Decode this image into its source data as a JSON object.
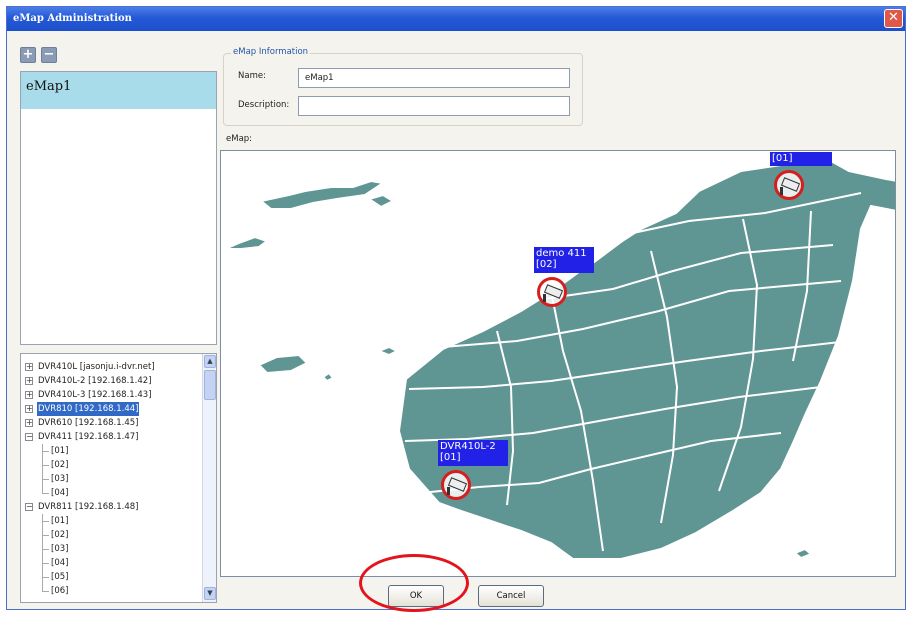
{
  "window": {
    "title": "eMap Administration",
    "close_glyph": "✕"
  },
  "toolbar": {
    "add_glyph": "+",
    "remove_glyph": "−"
  },
  "map_list": [
    "eMap1"
  ],
  "device_tree": [
    {
      "label": "DVR410L [jasonju.i-dvr.net]",
      "expander": "+",
      "children": []
    },
    {
      "label": "DVR410L-2 [192.168.1.42]",
      "expander": "+",
      "children": []
    },
    {
      "label": "DVR410L-3 [192.168.1.43]",
      "expander": "+",
      "children": []
    },
    {
      "label": "DVR810 [192.168.1.44]",
      "expander": "+",
      "selected": true,
      "children": []
    },
    {
      "label": "DVR610 [192.168.1.45]",
      "expander": "+",
      "children": []
    },
    {
      "label": "DVR411 [192.168.1.47]",
      "expander": "−",
      "children": [
        "[01]",
        "[02]",
        "[03]",
        "[04]"
      ]
    },
    {
      "label": "DVR811 [192.168.1.48]",
      "expander": "−",
      "children": [
        "[01]",
        "[02]",
        "[03]",
        "[04]",
        "[05]",
        "[06]"
      ]
    }
  ],
  "info": {
    "group_title": "eMap Information",
    "name_label": "Name:",
    "name_value": "eMap1",
    "description_label": "Description:",
    "description_value": ""
  },
  "emap": {
    "label": "eMap:",
    "markers": [
      {
        "device": "",
        "channel": "[01]"
      },
      {
        "device": "demo 411",
        "channel": "[02]"
      },
      {
        "device": "DVR410L-2",
        "channel": "[01]"
      }
    ]
  },
  "buttons": {
    "ok": "OK",
    "cancel": "Cancel"
  },
  "colors": {
    "map_land": "#5f9593",
    "title_bar": "#2459d6",
    "selection": "#3169c6",
    "marker_label": "#2121e8",
    "highlight": "#e3141d"
  }
}
